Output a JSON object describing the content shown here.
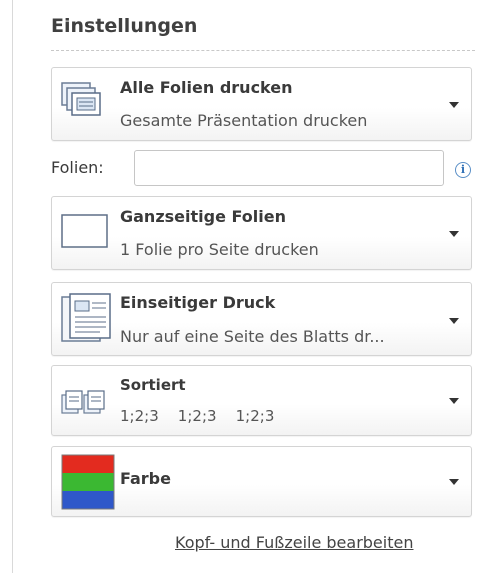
{
  "settings": {
    "heading": "Einstellungen",
    "slides_option": {
      "title": "Alle Folien drucken",
      "subtitle": "Gesamte Präsentation drucken",
      "icon": "print-all-slides-icon"
    },
    "slides_field": {
      "label": "Folien:",
      "value": "",
      "info_icon": "info-icon",
      "info_glyph": "i"
    },
    "layout_option": {
      "title": "Ganzseitige Folien",
      "subtitle": "1 Folie pro Seite drucken",
      "icon": "full-page-slide-icon"
    },
    "sides_option": {
      "title": "Einseitiger Druck",
      "subtitle": "Nur auf eine Seite des Blatts dr...",
      "icon": "single-sided-print-icon"
    },
    "collate_option": {
      "title": "Sortiert",
      "subtitle": "1;2;3    1;2;3    1;2;3",
      "icon": "collated-icon"
    },
    "color_option": {
      "title": "Farbe",
      "icon": "color-icon",
      "colors": [
        "#e32b1f",
        "#3bb832",
        "#2f58c9"
      ]
    },
    "footer_link": "Kopf- und Fußzeile bearbeiten"
  }
}
